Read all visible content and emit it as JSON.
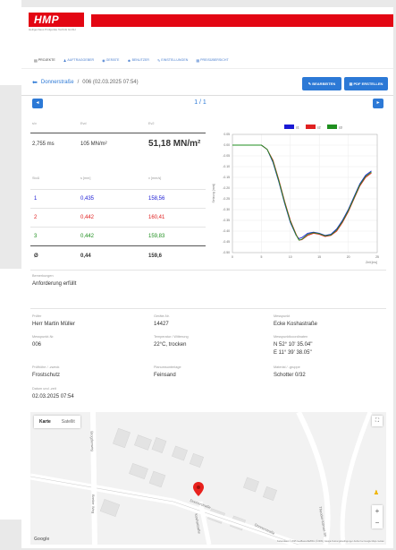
{
  "header": {
    "logo_text": "HMP",
    "logo_subtitle": "Heiligenhaus Prüfgeräte Technik GmbH"
  },
  "nav": [
    {
      "icon": "▤",
      "label": "PROJEKTE",
      "active": true
    },
    {
      "icon": "♟",
      "label": "AUFTRAGGEBER",
      "active": false
    },
    {
      "icon": "◉",
      "label": "GERÄTE",
      "active": false
    },
    {
      "icon": "☻",
      "label": "BENUTZER",
      "active": false
    },
    {
      "icon": "✎",
      "label": "EINSTELLUNGEN",
      "active": false
    },
    {
      "icon": "▦",
      "label": "PREISÜBERSICHT",
      "active": false
    }
  ],
  "breadcrumb": {
    "back_icon": "⬅",
    "project": "Donnerstraße",
    "separator": "/",
    "current": "006 (02.03.2025 07:54)"
  },
  "buttons": {
    "edit": "✎ BEARBEITEN",
    "pdf": "▤ PDF ERSTELLEN"
  },
  "pager": {
    "prev_icon": "◂",
    "next_icon": "▸",
    "text": "1 / 1"
  },
  "summary": {
    "labels": [
      "s/v",
      "Evd",
      "Ev2"
    ],
    "values": [
      "2,755 ms",
      "105 MN/m²",
      "51,18 MN/m²"
    ]
  },
  "drops": {
    "headers": [
      "Stoß",
      "s [mm]",
      "v [mm/s]"
    ],
    "rows": [
      {
        "n": "1",
        "s": "0,435",
        "v": "158,56",
        "color": "#1a1ad4"
      },
      {
        "n": "2",
        "s": "0,442",
        "v": "160,41",
        "color": "#e02020"
      },
      {
        "n": "3",
        "s": "0,442",
        "v": "159,83",
        "color": "#1f8f1f"
      }
    ],
    "avg": {
      "n": "Ø",
      "s": "0,44",
      "v": "159,6"
    }
  },
  "remarks": {
    "label": "Bemerkungen",
    "value": "Anforderung erfüllt"
  },
  "details": [
    {
      "label": "Prüfer",
      "value": "Herr Martin Müller"
    },
    {
      "label": "Geräte-Nr.",
      "value": "14427"
    },
    {
      "label": "Messpunkt",
      "value": "Ecke Koshastraße"
    },
    {
      "label": "Messpunkt-Nr.",
      "value": "006"
    },
    {
      "label": "Temperatur / Witterung",
      "value": "22°C, trocken"
    },
    {
      "label": "Messpunktkoordinaten",
      "value": "N 52° 10' 35.04''"
    },
    {
      "label": "",
      "value": "E 11° 39' 38.05''"
    },
    {
      "label": "Prüfhöhe / -zweck",
      "value": "Frostschutz"
    },
    {
      "label": "Planumsunterlage",
      "value": "Feinsand"
    },
    {
      "label": "Material / -gruppe",
      "value": "Schotter 0/32"
    },
    {
      "label": "Datum und -zeit",
      "value": "02.03.2025 07:54"
    }
  ],
  "map": {
    "tab_map": "Karte",
    "tab_satellite": "Satellit",
    "fullscreen_icon": "⛶",
    "pegman_icon": "♟",
    "zoom_in": "+",
    "zoom_out": "−",
    "google": "Google",
    "attribution": "Kartendaten © 2025 GeoBasis-DE/BKG (©2009), Google   Nutzungsbedingungen   Fehler bei Google Maps melden",
    "streets": [
      "Donnerstraße",
      "Koshastraße",
      "Donnerstraße",
      "Brogdenweg",
      "Breiter Weg",
      "Theodor-Körner-Str"
    ]
  },
  "chart_data": {
    "type": "line",
    "legend": [
      "s1",
      "s2",
      "s3"
    ],
    "legend_position": "top",
    "colors": [
      "#1a1ad4",
      "#e02020",
      "#1f8f1f"
    ],
    "ylabel": "Setzung [mm]",
    "xlabel": "Zeit [ms]",
    "xlim": [
      0,
      25
    ],
    "ylim": [
      -0.5,
      0.05
    ],
    "xticks": [
      0,
      5,
      10,
      15,
      20,
      25
    ],
    "yticks": [
      0.05,
      0,
      -0.05,
      -0.1,
      -0.15,
      -0.2,
      -0.25,
      -0.3,
      -0.35,
      -0.4,
      -0.45,
      -0.5
    ],
    "ytick_labels": [
      "0.05",
      "0.00",
      "-0.05",
      "-0.10",
      "-0.15",
      "-0.20",
      "-0.25",
      "-0.30",
      "-0.35",
      "-0.40",
      "-0.45",
      "-0.50"
    ],
    "grid": true,
    "series": [
      {
        "name": "s1",
        "x": [
          0,
          3,
          5,
          6,
          7,
          8,
          9,
          10,
          11,
          11.5,
          12,
          13,
          14,
          15,
          16,
          17,
          18,
          19,
          20,
          21,
          22,
          23,
          24
        ],
        "y": [
          0,
          0,
          0,
          -0.02,
          -0.08,
          -0.17,
          -0.27,
          -0.36,
          -0.42,
          -0.435,
          -0.43,
          -0.41,
          -0.405,
          -0.41,
          -0.42,
          -0.415,
          -0.39,
          -0.35,
          -0.3,
          -0.24,
          -0.18,
          -0.14,
          -0.12
        ]
      },
      {
        "name": "s2",
        "x": [
          0,
          3,
          5,
          6,
          7,
          8,
          9,
          10,
          11,
          11.5,
          12,
          13,
          14,
          15,
          16,
          17,
          18,
          19,
          20,
          21,
          22,
          23,
          24
        ],
        "y": [
          0,
          0,
          0,
          -0.02,
          -0.07,
          -0.16,
          -0.26,
          -0.35,
          -0.415,
          -0.442,
          -0.44,
          -0.42,
          -0.41,
          -0.415,
          -0.425,
          -0.42,
          -0.4,
          -0.36,
          -0.31,
          -0.25,
          -0.19,
          -0.15,
          -0.13
        ]
      },
      {
        "name": "s3",
        "x": [
          0,
          3,
          5,
          6,
          7,
          8,
          9,
          10,
          11,
          11.5,
          12,
          13,
          14,
          15,
          16,
          17,
          18,
          19,
          20,
          21,
          22,
          23,
          24
        ],
        "y": [
          0,
          0,
          0,
          -0.02,
          -0.075,
          -0.165,
          -0.265,
          -0.355,
          -0.418,
          -0.442,
          -0.438,
          -0.415,
          -0.407,
          -0.412,
          -0.422,
          -0.418,
          -0.395,
          -0.355,
          -0.305,
          -0.245,
          -0.185,
          -0.145,
          -0.125
        ]
      }
    ]
  }
}
